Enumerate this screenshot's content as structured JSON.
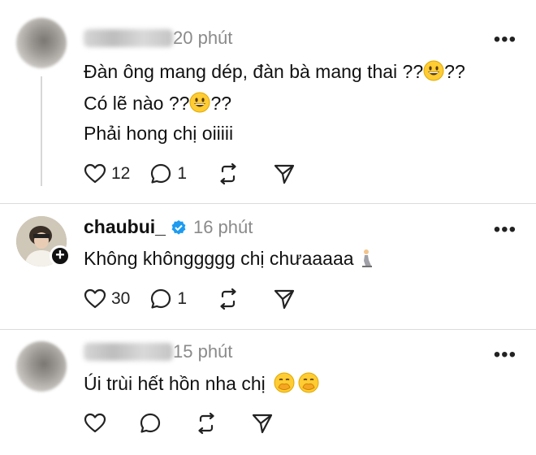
{
  "comments": [
    {
      "username": "",
      "time": "20 phút",
      "lines": [
        "Đàn ông mang dép, đàn bà mang thai ??",
        "??",
        "Có lẽ nào ??",
        "??",
        "Phải hong chị oiiiii"
      ],
      "likes": "12",
      "replies": "1"
    },
    {
      "username": "chaubui_",
      "time": "16 phút",
      "lines": [
        "Không khônggggg chị chưaaaaa"
      ],
      "likes": "30",
      "replies": "1"
    },
    {
      "username": "",
      "time": "15 phút",
      "lines": [
        "Úi trùi hết hồn nha chị"
      ],
      "likes": "",
      "replies": ""
    }
  ],
  "icons": {
    "like": "heart-icon",
    "reply": "comment-icon",
    "repost": "repost-icon",
    "share": "send-icon",
    "more": "more-icon",
    "verified": "verified-badge-icon",
    "follow": "plus-icon"
  },
  "colors": {
    "verified": "#1d9bf0",
    "muted": "#8a8a8a"
  }
}
